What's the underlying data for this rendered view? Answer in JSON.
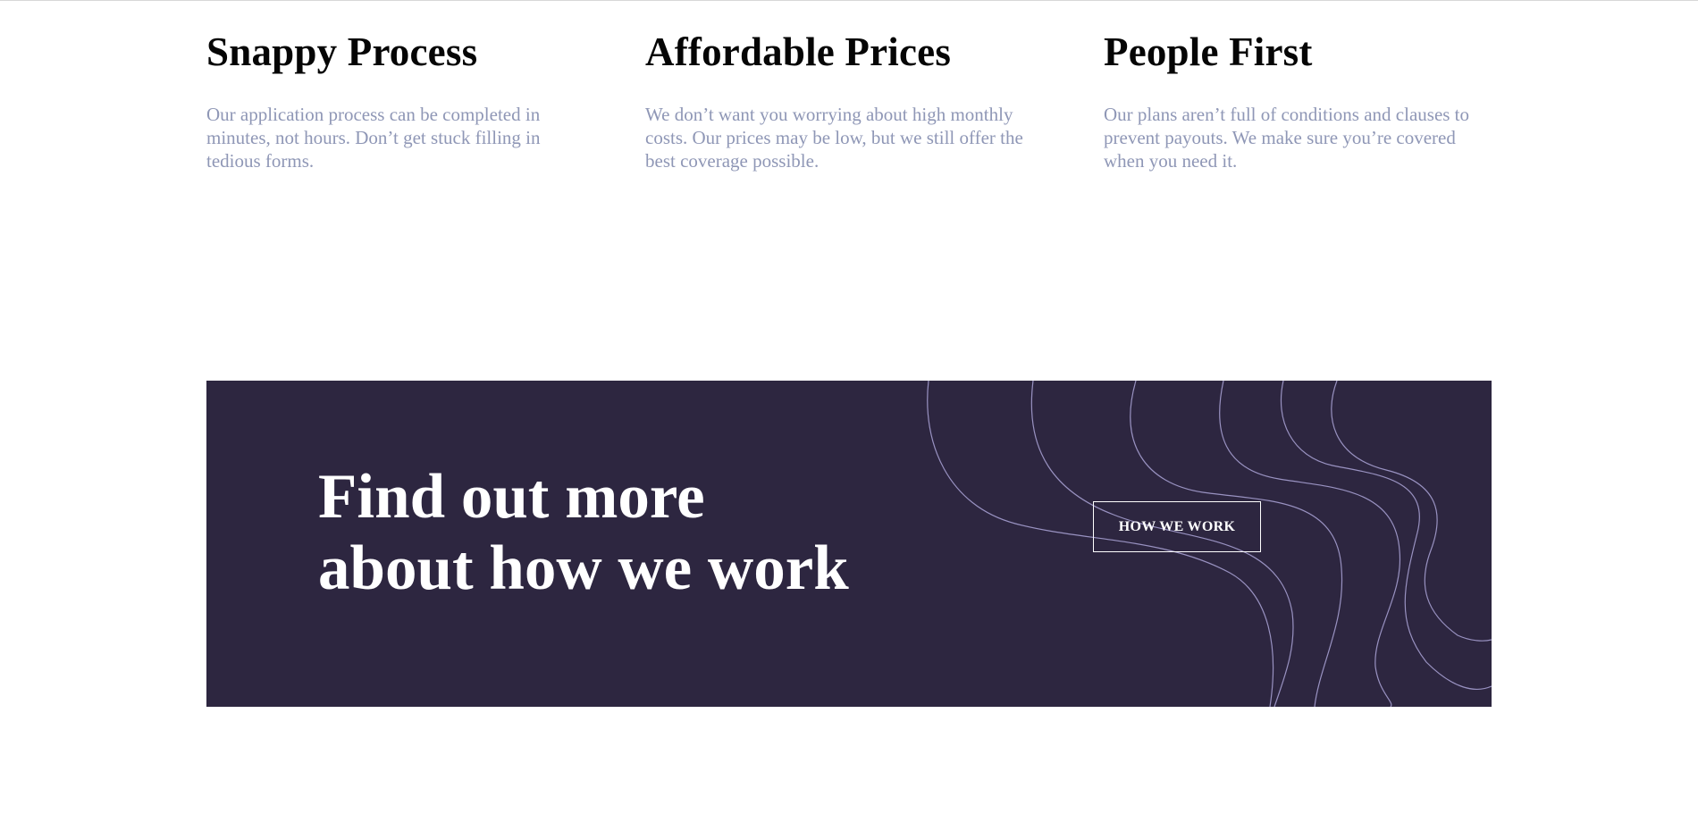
{
  "features": [
    {
      "title": "Snappy Process",
      "text": "Our application process can be completed in minutes, not hours. Don’t get stuck filling in tedious forms."
    },
    {
      "title": "Affordable Prices",
      "text": "We don’t want you worrying about high monthly costs. Our prices may be low, but we still offer the best coverage possible."
    },
    {
      "title": "People First",
      "text": "Our plans aren’t full of conditions and clauses to prevent payouts. We make sure you’re covered when you need it."
    }
  ],
  "cta": {
    "heading_line1": "Find out more",
    "heading_line2": "about how we work",
    "button_label": "HOW WE WORK"
  },
  "colors": {
    "banner_bg": "#2d2640",
    "body_text": "#8f97b6",
    "heading": "#050505",
    "wave_stroke": "#a59ed0"
  }
}
